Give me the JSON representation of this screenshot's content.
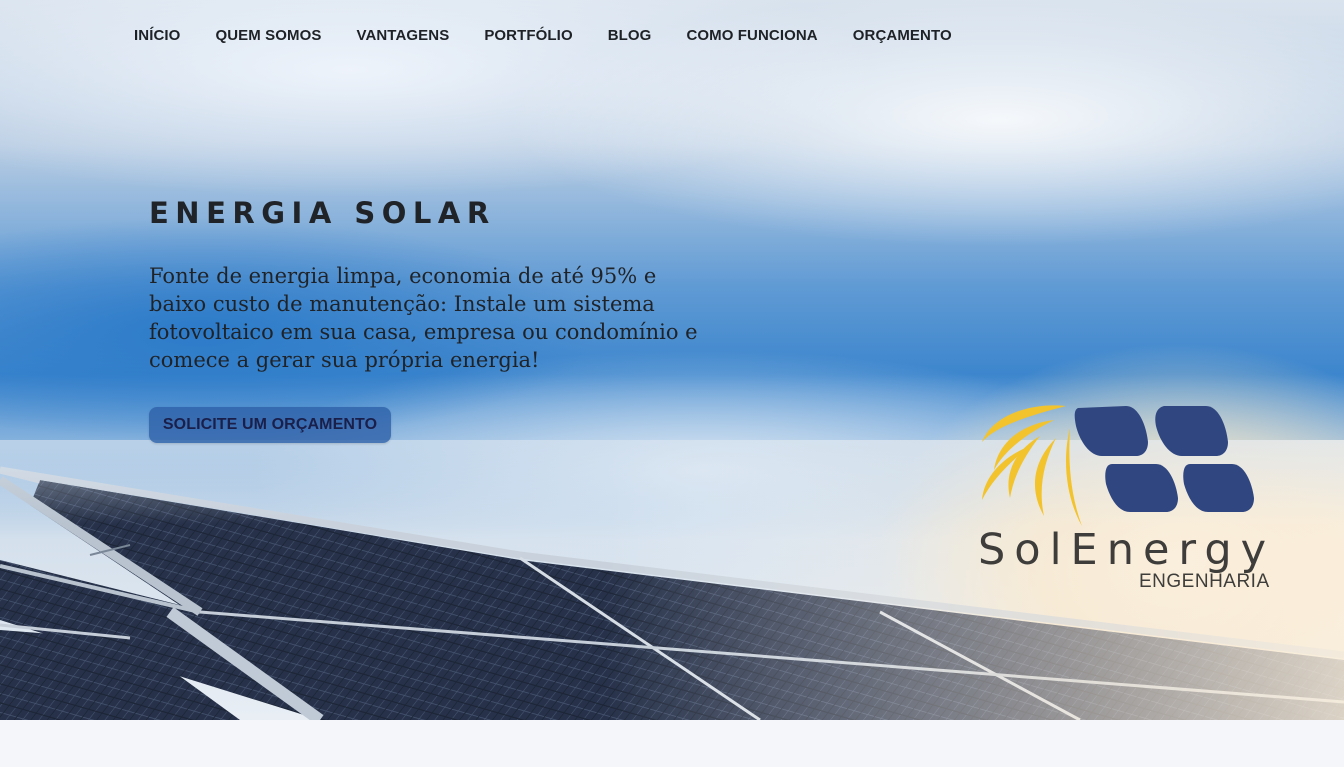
{
  "nav": {
    "items": [
      {
        "label": "INÍCIO"
      },
      {
        "label": "QUEM SOMOS"
      },
      {
        "label": "VANTAGENS"
      },
      {
        "label": "PORTFÓLIO"
      },
      {
        "label": "BLOG"
      },
      {
        "label": "COMO FUNCIONA"
      },
      {
        "label": "ORÇAMENTO"
      }
    ]
  },
  "hero": {
    "title": "ENERGIA SOLAR",
    "description": "Fonte de energia limpa, economia de até 95% e baixo custo de manutenção: Instale um sistema fotovoltaico em sua casa, empresa ou condomínio e comece a gerar sua própria energia!",
    "cta_label": "SOLICITE UM ORÇAMENTO"
  },
  "logo": {
    "text": "SolEnergy",
    "subtitle": "ENGENHARIA"
  },
  "colors": {
    "text_dark": "#202428",
    "cta_background": "#2e62aa",
    "cta_text": "#1a1f4a",
    "logo_blue": "#2f4680",
    "logo_yellow": "#f2c32c",
    "logo_gray": "#3e3d3b",
    "page_background": "#f4f6f9"
  }
}
